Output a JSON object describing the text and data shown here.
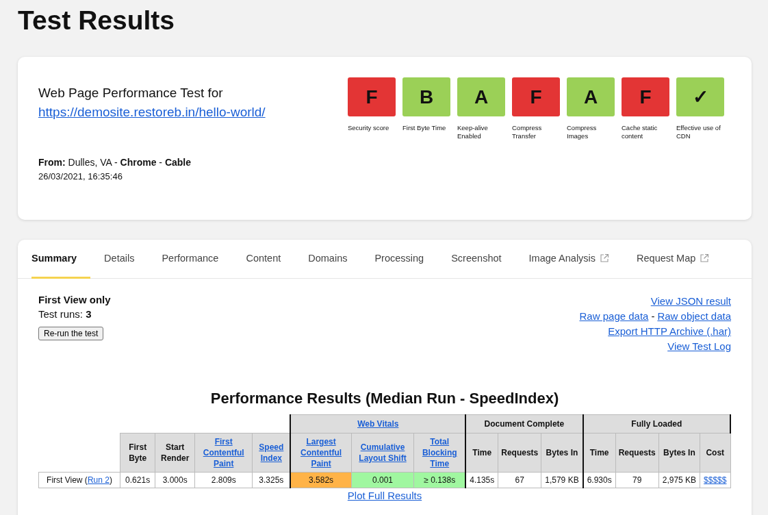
{
  "page_title": "Test Results",
  "summary": {
    "heading": "Web Page Performance Test for",
    "url": "https://demosite.restoreb.in/hello-world/",
    "from_label": "From:",
    "location": "Dulles, VA",
    "sep1": "-",
    "browser": "Chrome",
    "sep2": "-",
    "connection": "Cable",
    "timestamp": "26/03/2021, 16:35:46",
    "grades": [
      {
        "grade": "F",
        "label": "Security score",
        "color": "#e33535"
      },
      {
        "grade": "B",
        "label": "First Byte Time",
        "color": "#9bd057"
      },
      {
        "grade": "A",
        "label": "Keep-alive Enabled",
        "color": "#9bd057"
      },
      {
        "grade": "F",
        "label": "Compress Transfer",
        "color": "#e33535"
      },
      {
        "grade": "A",
        "label": "Compress Images",
        "color": "#9bd057"
      },
      {
        "grade": "F",
        "label": "Cache static content",
        "color": "#e33535"
      },
      {
        "grade": "✓",
        "label": "Effective use of CDN",
        "color": "#9bd057"
      }
    ]
  },
  "tabs": [
    {
      "label": "Summary",
      "selected": true,
      "external": false
    },
    {
      "label": "Details",
      "selected": false,
      "external": false
    },
    {
      "label": "Performance",
      "selected": false,
      "external": false
    },
    {
      "label": "Content",
      "selected": false,
      "external": false
    },
    {
      "label": "Domains",
      "selected": false,
      "external": false
    },
    {
      "label": "Processing",
      "selected": false,
      "external": false
    },
    {
      "label": "Screenshot",
      "selected": false,
      "external": false
    },
    {
      "label": "Image Analysis",
      "selected": false,
      "external": true
    },
    {
      "label": "Request Map",
      "selected": false,
      "external": true
    }
  ],
  "run_info": {
    "view": "First View only",
    "runs_label": "Test runs:",
    "runs": "3",
    "rerun_button": "Re-run the test"
  },
  "links": [
    [
      "View JSON result"
    ],
    [
      "Raw page data",
      "-",
      "Raw object data"
    ],
    [
      "Export HTTP Archive (.har)"
    ],
    [
      "View Test Log"
    ]
  ],
  "results": {
    "title": "Performance Results (Median Run - SpeedIndex)",
    "groups": [
      {
        "columns": [
          {
            "label": "First Byte",
            "link": false
          },
          {
            "label": "Start Render",
            "link": false
          },
          {
            "label": "First Contentful Paint",
            "link": true
          },
          {
            "label": "Speed Index",
            "link": true
          }
        ]
      },
      {
        "label": "Web Vitals",
        "link": true,
        "columns": [
          {
            "label": "Largest Contentful Paint",
            "link": true
          },
          {
            "label": "Cumulative Layout Shift",
            "link": true
          },
          {
            "label": "Total Blocking Time",
            "link": true
          }
        ]
      },
      {
        "label": "Document Complete",
        "link": false,
        "columns": [
          {
            "label": "Time",
            "link": false
          },
          {
            "label": "Requests",
            "link": false
          },
          {
            "label": "Bytes In",
            "link": false
          }
        ]
      },
      {
        "label": "Fully Loaded",
        "link": false,
        "columns": [
          {
            "label": "Time",
            "link": false
          },
          {
            "label": "Requests",
            "link": false
          },
          {
            "label": "Bytes In",
            "link": false
          },
          {
            "label": "Cost",
            "link": false
          }
        ]
      }
    ],
    "row": {
      "prefix": "First View (",
      "run_link": "Run 2",
      "suffix": ")",
      "cells": [
        {
          "text": "0.621s"
        },
        {
          "text": "3.000s"
        },
        {
          "text": "2.809s"
        },
        {
          "text": "3.325s"
        },
        {
          "text": "3.582s",
          "color": "#ffb347"
        },
        {
          "text": "0.001",
          "color": "#a0f7a0"
        },
        {
          "text": "≥ 0.138s",
          "color": "#a0f7a0"
        },
        {
          "text": "4.135s"
        },
        {
          "text": "67"
        },
        {
          "text": "1,579 KB"
        },
        {
          "text": "6.930s"
        },
        {
          "text": "79"
        },
        {
          "text": "2,975 KB"
        },
        {
          "text": "$$$$$",
          "link": true
        }
      ]
    },
    "plot_link": "Plot Full Results"
  }
}
